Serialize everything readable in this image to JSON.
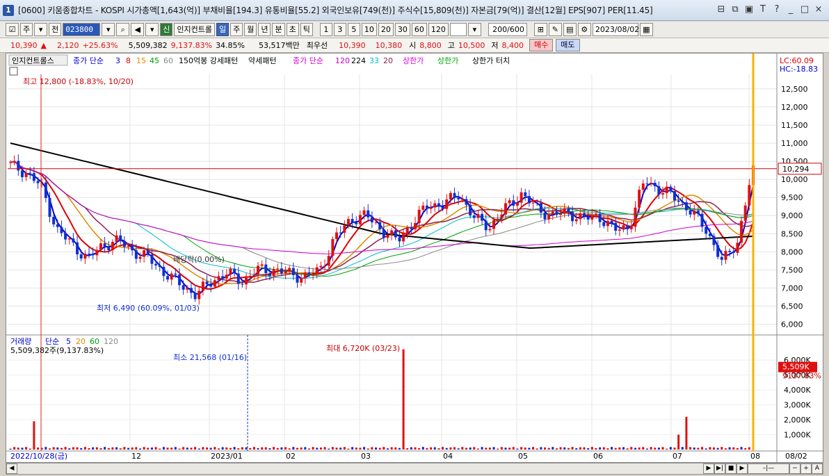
{
  "window": {
    "badge": "1",
    "title": "[0600] 키움종합차트 - KOSPI 시가총액[1,643(억)] 부채비율[194.3] 유통비율[55.2] 외국인보유[749(천)] 주식수[15,809(천)] 자본금[79(억)] 결산[12월] EPS[907] PER[11.45]",
    "controls": [
      "⊟",
      "⧉",
      "▣",
      "T",
      "?",
      "_",
      "□",
      "×"
    ]
  },
  "toolbar": {
    "period_main": "주",
    "period_alt": "전",
    "stock_code": "023800",
    "indicator_badge": "신",
    "indicator_control": "인지컨트롤",
    "periods": [
      "일",
      "주",
      "월",
      "년",
      "분",
      "초",
      "틱"
    ],
    "period_selected": "일",
    "intervals": [
      "1",
      "3",
      "5",
      "10",
      "20",
      "30",
      "60",
      "120"
    ],
    "count": "200/600",
    "date": "2023/08/02"
  },
  "quote": {
    "price": "10,390",
    "change_arrow": "▲",
    "change": "2,120",
    "change_rate": "+25.63%",
    "volume": "5,509,382",
    "volume_ratio": "9,137.83%",
    "turnover": "34.85%",
    "amount": "53,517백만",
    "stock_type": "최우선",
    "ask": "10,390",
    "bid": "10,380",
    "open_label": "시",
    "open": "8,800",
    "high_label": "고",
    "high": "10,500",
    "low_label": "저",
    "low": "8,400",
    "buy": "매수",
    "sell": "매도"
  },
  "legend": {
    "controls_label": "인지컨트롤스",
    "ma_label": "종가 단순",
    "ma_periods": [
      {
        "p": "3",
        "color": "#0000cc"
      },
      {
        "p": "8",
        "color": "#dd0000"
      },
      {
        "p": "15",
        "color": "#e08a00"
      },
      {
        "p": "45",
        "color": "#00a000"
      },
      {
        "p": "60",
        "color": "#888888"
      }
    ],
    "pattern1": "150억봉 강세패턴",
    "pattern2": "약세패턴",
    "ma2_label": "종가 단순",
    "ma2_periods": [
      {
        "p": "120",
        "color": "#cc00cc"
      },
      {
        "p": "224",
        "color": "#000000"
      },
      {
        "p": "33",
        "color": "#00bbcc"
      },
      {
        "p": "20",
        "color": "#8b2252"
      }
    ],
    "limit_up": "상한가",
    "limit_up2": "상한가",
    "limit_touch": "상한가 터치",
    "lc": "LC:60.09",
    "hc": "HC:-18.83"
  },
  "chart_data": {
    "type": "candlestick",
    "price_axis": {
      "min": 6000,
      "max": 12800,
      "ticks": [
        "12,500",
        "12,000",
        "11,500",
        "11,000",
        "10,500",
        "10,000",
        "9,500",
        "9,000",
        "8,500",
        "8,000",
        "7,500",
        "7,000",
        "6,500",
        "6,000"
      ]
    },
    "current_price_tag": "10,294",
    "dividend_marker": "배당락(0.00%)",
    "annotations": {
      "high": "최고 12,800 (-18.83%, 10/20)",
      "low": "최저 6,490 (60.09%, 01/03)",
      "vol_max": "최대 6,720K (03/23)",
      "vol_min": "최소 21,568 (01/16)"
    },
    "x_labels": [
      "2022/10/28(금)",
      "12",
      "2023/01",
      "02",
      "03",
      "04",
      "05",
      "06",
      "07",
      "08",
      "08/02"
    ],
    "close_series_approx": [
      10390,
      10200,
      9800,
      8600,
      8200,
      7800,
      8200,
      8300,
      8000,
      7800,
      7400,
      7100,
      6800,
      7200,
      7400,
      7200,
      7500,
      7500,
      7400,
      7300,
      7500,
      8400,
      8900,
      9000,
      8600,
      8300,
      8800,
      9300,
      9300,
      9600,
      8900,
      8700,
      9200,
      9600,
      9200,
      9000,
      9100,
      8900,
      9000,
      8600,
      8700,
      10000,
      9700,
      9500,
      9100,
      8600,
      7700,
      8300,
      10390
    ],
    "volume": {
      "title": "거래량",
      "ma_label": "단순",
      "ma_periods": [
        {
          "p": "5",
          "color": "#0000cc"
        },
        {
          "p": "20",
          "color": "#e08a00"
        },
        {
          "p": "60",
          "color": "#00a000"
        },
        {
          "p": "120",
          "color": "#888888"
        }
      ],
      "current": "5,509,382주(9,137.83%)",
      "axis_ticks": [
        "6,000K",
        "5,000K",
        "4,000K",
        "3,000K",
        "2,000K",
        "1,000K"
      ],
      "current_tag": "5,509K",
      "current_pct": "9137.83%"
    }
  },
  "colors": {
    "up": "#e01010",
    "down": "#1030d0",
    "accent": "#3c66b8"
  }
}
